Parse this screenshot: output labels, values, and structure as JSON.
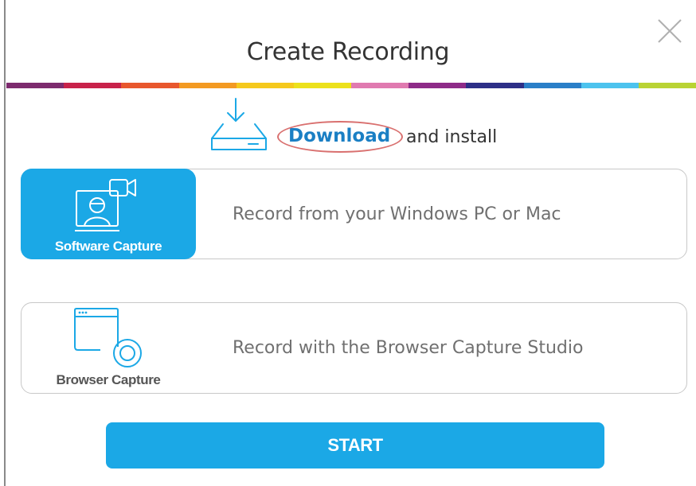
{
  "dialog": {
    "title": "Create Recording",
    "close_icon": "close-icon",
    "rainbow_colors": [
      "#7d2b6e",
      "#c8224a",
      "#e8572d",
      "#f39a22",
      "#f5c91c",
      "#ece11b",
      "#e07ab0",
      "#8e2b88",
      "#2d2f87",
      "#2a7fc8",
      "#4cc3ee",
      "#b9d334"
    ]
  },
  "download": {
    "icon": "download-tray-icon",
    "link_label": "Download",
    "rest_label": "and install"
  },
  "options": [
    {
      "tile_label": "Software Capture",
      "icon": "webcam-presenter-icon",
      "description": "Record from your Windows PC or Mac",
      "selected": true
    },
    {
      "tile_label": "Browser Capture",
      "icon": "browser-record-icon",
      "description": "Record with the Browser Capture Studio",
      "selected": false
    }
  ],
  "start_label": "START",
  "colors": {
    "accent": "#1ba8e6",
    "link": "#1a7fc4",
    "annotation_oval": "#d9706f"
  }
}
